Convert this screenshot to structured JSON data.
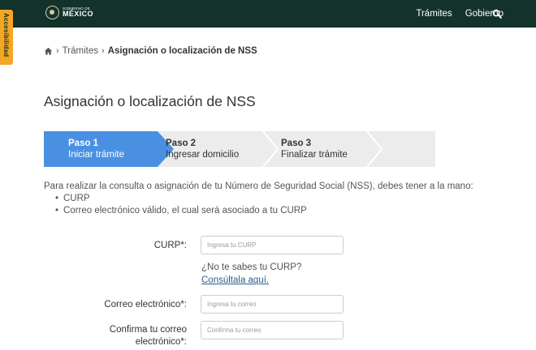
{
  "header": {
    "logo_line1": "GOBIERNO DE",
    "logo_line2": "MÉXICO",
    "nav": [
      "Trámites",
      "Gobierno"
    ],
    "search_icon": "search-icon"
  },
  "accessibility": {
    "label": "Accesibilidad"
  },
  "breadcrumb": {
    "home_icon": "home-icon",
    "link": "Trámites",
    "current": "Asignación o localización de NSS"
  },
  "title": "Asignación o localización de NSS",
  "steps": [
    {
      "title": "Paso 1",
      "subtitle": "Iniciar trámite",
      "active": true
    },
    {
      "title": "Paso 2",
      "subtitle": "Ingresar domicilio",
      "active": false
    },
    {
      "title": "Paso 3",
      "subtitle": "Finalizar trámite",
      "active": false
    }
  ],
  "intro": "Para realizar la consulta o asignación de tu Número de Seguridad Social (NSS), debes tener a la mano:",
  "requirements": [
    "CURP",
    "Correo electrónico válido, el cual será asociado a tu CURP"
  ],
  "form": {
    "curp_label": "CURP*:",
    "curp_placeholder": "Ingresa tu CURP",
    "curp_help_question": "¿No te sabes tu CURP?",
    "curp_help_link": "Consúltala aquí.",
    "email_label": "Correo electrónico*:",
    "email_placeholder": "Ingresa tu correo",
    "confirm_label_line1": "Confirma tu correo",
    "confirm_label_line2": "electrónico*:",
    "confirm_placeholder": "Confirma tu correo"
  },
  "colors": {
    "header_bg": "#13322b",
    "accent": "#4a90e2",
    "access_tab": "#f5a623",
    "link": "#2a5d8f"
  }
}
